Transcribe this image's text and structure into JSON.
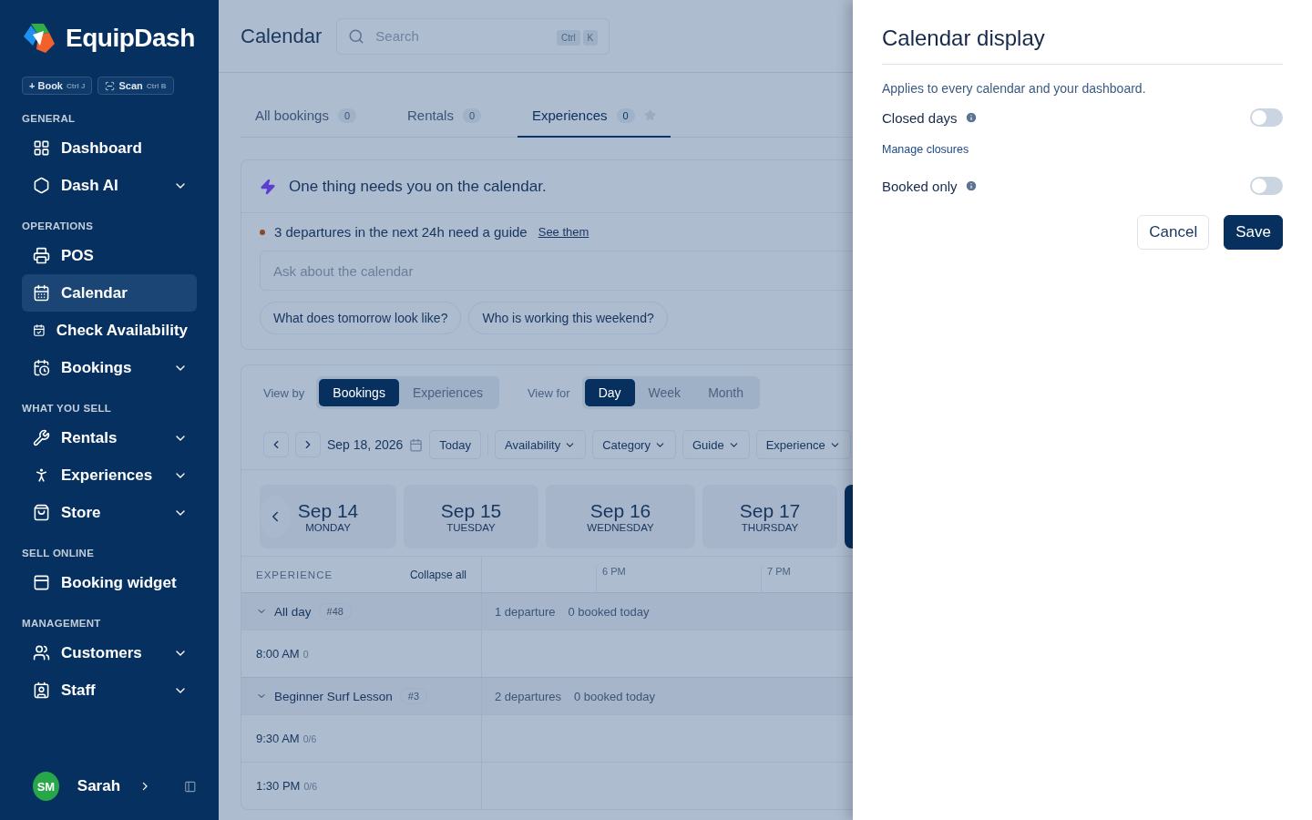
{
  "sidebar": {
    "brand": "EquipDash",
    "quick_actions": [
      {
        "label": "+ Book",
        "shortcut": "Ctrl J"
      },
      {
        "label": "Scan",
        "shortcut": "Ctrl B"
      }
    ],
    "sections": [
      {
        "title": "GENERAL",
        "items": [
          {
            "label": "Dashboard",
            "selected": false,
            "expandable": false
          },
          {
            "label": "Dash AI",
            "selected": false,
            "expandable": true
          }
        ]
      },
      {
        "title": "OPERATIONS",
        "items": [
          {
            "label": "POS",
            "selected": false,
            "expandable": false
          },
          {
            "label": "Calendar",
            "selected": true,
            "expandable": false
          },
          {
            "label": "Check Availability",
            "selected": false,
            "expandable": false
          },
          {
            "label": "Bookings",
            "selected": false,
            "expandable": true
          }
        ]
      },
      {
        "title": "WHAT YOU SELL",
        "items": [
          {
            "label": "Rentals",
            "selected": false,
            "expandable": true
          },
          {
            "label": "Experiences",
            "selected": false,
            "expandable": true
          },
          {
            "label": "Store",
            "selected": false,
            "expandable": true
          }
        ]
      },
      {
        "title": "SELL ONLINE",
        "items": [
          {
            "label": "Booking widget",
            "selected": false,
            "expandable": false
          }
        ]
      },
      {
        "title": "MANAGEMENT",
        "items": [
          {
            "label": "Customers",
            "selected": false,
            "expandable": true
          },
          {
            "label": "Staff",
            "selected": false,
            "expandable": true
          }
        ]
      }
    ],
    "user": {
      "initials": "SM",
      "name": "Sarah"
    }
  },
  "header": {
    "title": "Calendar",
    "search": {
      "placeholder": "Search",
      "keys": [
        "Ctrl",
        "K"
      ]
    }
  },
  "tabs": [
    {
      "label": "All bookings",
      "count": "0",
      "selected": false
    },
    {
      "label": "Rentals",
      "count": "0",
      "selected": false
    },
    {
      "label": "Experiences",
      "count": "0",
      "selected": true
    }
  ],
  "assistant": {
    "title": "One thing needs you on the calendar.",
    "alert": {
      "text": "3 departures in the next 24h need a guide",
      "link": "See them"
    },
    "ask": {
      "placeholder": "Ask about the calendar"
    },
    "suggestions": [
      "What does tomorrow look like?",
      "Who is working this weekend?"
    ]
  },
  "toolbar": {
    "view_by": {
      "label": "View by",
      "options": [
        {
          "label": "Bookings",
          "selected": true
        },
        {
          "label": "Experiences",
          "selected": false
        }
      ]
    },
    "view_for": {
      "label": "View for",
      "options": [
        {
          "label": "Day",
          "selected": true
        },
        {
          "label": "Week",
          "selected": false
        },
        {
          "label": "Month",
          "selected": false
        }
      ]
    },
    "date": "Sep 18, 2026",
    "today": "Today",
    "filters": [
      "Availability",
      "Category",
      "Guide",
      "Experience"
    ]
  },
  "days": [
    {
      "date": "Sep 14",
      "weekday": "MONDAY"
    },
    {
      "date": "Sep 15",
      "weekday": "TUESDAY"
    },
    {
      "date": "Sep 16",
      "weekday": "WEDNESDAY"
    },
    {
      "date": "Sep 17",
      "weekday": "THURSDAY"
    }
  ],
  "grid": {
    "column_header": "EXPERIENCE",
    "collapse": "Collapse all",
    "hours": [
      "6 PM",
      "7 PM"
    ],
    "groups": [
      {
        "name": "All day",
        "count": "#48",
        "expanded": true,
        "departures": "1 departure",
        "booked": "0 booked today",
        "slots": [
          {
            "time": "8:00 AM",
            "capacity": "0"
          }
        ]
      },
      {
        "name": "Beginner Surf Lesson",
        "count": "#3",
        "expanded": true,
        "departures": "2 departures",
        "booked": "0 booked today",
        "slots": [
          {
            "time": "9:30 AM",
            "capacity": "0/6"
          },
          {
            "time": "1:30 PM",
            "capacity": "0/6"
          }
        ]
      }
    ]
  },
  "drawer": {
    "title": "Calendar display",
    "description": "Applies to every calendar and your dashboard.",
    "settings": [
      {
        "label": "Closed days",
        "on": false,
        "link": "Manage closures"
      },
      {
        "label": "Booked only",
        "on": false
      }
    ],
    "buttons": [
      {
        "label": "Cancel",
        "kind": "secondary"
      },
      {
        "label": "Save",
        "kind": "primary"
      }
    ]
  }
}
